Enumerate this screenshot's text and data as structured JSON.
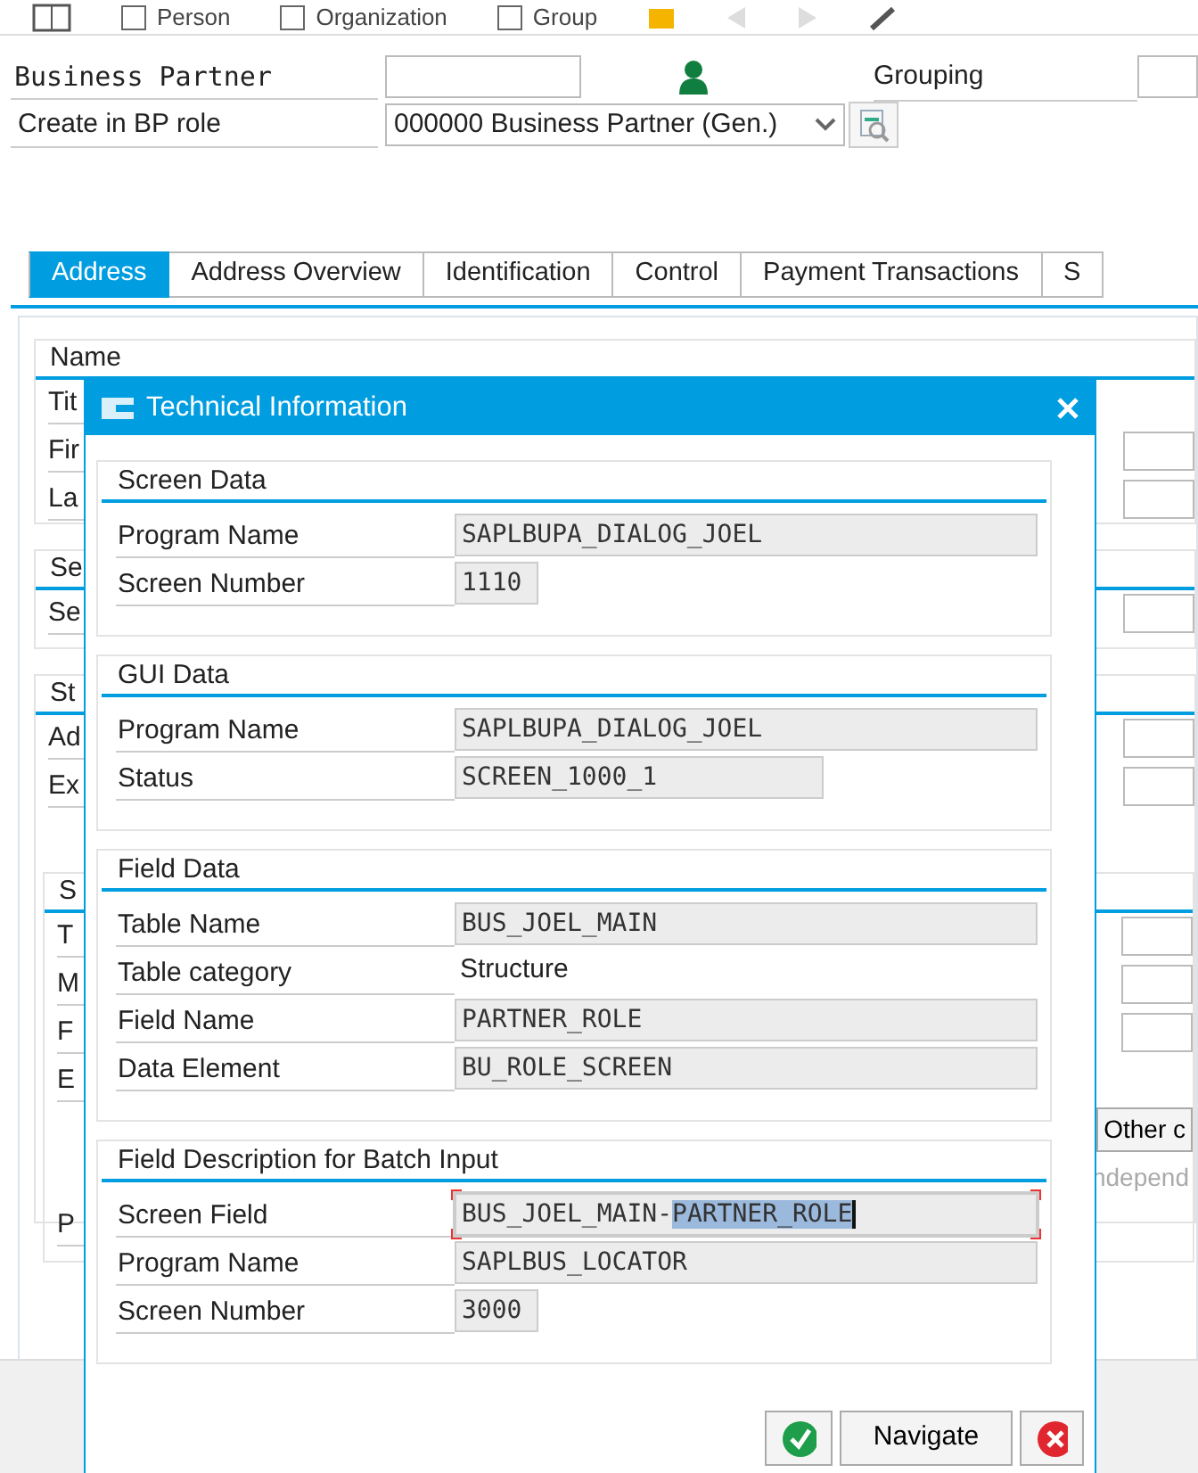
{
  "toolbar": {
    "buttons": [
      {
        "label": "Person",
        "checked": false
      },
      {
        "label": "Organization",
        "checked": false
      },
      {
        "label": "Group",
        "checked": false
      }
    ]
  },
  "header": {
    "business_partner": {
      "label": "Business Partner"
    },
    "grouping": {
      "label": "Grouping"
    },
    "role": {
      "label": "Create in BP role",
      "value": "000000 Business Partner (Gen.)"
    }
  },
  "tabs": [
    {
      "label": "Address",
      "selected": true
    },
    {
      "label": "Address Overview",
      "selected": false
    },
    {
      "label": "Identification",
      "selected": false
    },
    {
      "label": "Control",
      "selected": false
    },
    {
      "label": "Payment Transactions",
      "selected": false
    },
    {
      "label": "S",
      "selected": false
    }
  ],
  "background_groups": [
    {
      "title": "Name",
      "rows": [
        {
          "kind": "row",
          "label": "Tit",
          "field": false
        },
        {
          "kind": "row",
          "label": "Fir",
          "field": true
        },
        {
          "kind": "row",
          "label": "La",
          "field": true
        }
      ]
    },
    {
      "title": "Se",
      "rows": [
        {
          "kind": "row",
          "label": "Se",
          "field": true
        }
      ]
    },
    {
      "title": "St",
      "rows": [
        {
          "kind": "row",
          "label": "Ad",
          "field": true
        },
        {
          "kind": "row",
          "label": "Ex",
          "field": true
        }
      ],
      "subgroup": {
        "title": "S",
        "rows": [
          {
            "kind": "row",
            "label": "T",
            "field": true
          },
          {
            "kind": "row",
            "label": "M",
            "field": true
          },
          {
            "kind": "row",
            "label": "F",
            "field": true
          },
          {
            "kind": "row",
            "label": "E",
            "field": false
          },
          {
            "kind": "button",
            "text": "Other c"
          },
          {
            "kind": "disabled",
            "text": "ndepend"
          },
          {
            "kind": "row",
            "label": "P",
            "field": false
          }
        ]
      }
    }
  ],
  "dialog": {
    "title": "Technical Information",
    "groups": [
      {
        "title": "Screen Data",
        "rows": [
          {
            "label": "Program Name",
            "kind": "wide",
            "value": "SAPLBUPA_DIALOG_JOEL"
          },
          {
            "label": "Screen Number",
            "kind": "narrow",
            "value": "1110"
          }
        ]
      },
      {
        "title": "GUI Data",
        "rows": [
          {
            "label": "Program Name",
            "kind": "wide",
            "value": "SAPLBUPA_DIALOG_JOEL"
          },
          {
            "label": "Status",
            "kind": "medium",
            "value": "SCREEN_1000_1"
          }
        ]
      },
      {
        "title": "Field Data",
        "rows": [
          {
            "label": "Table Name",
            "kind": "wide",
            "value": "BUS_JOEL_MAIN"
          },
          {
            "label": "Table category",
            "kind": "plain",
            "value": "Structure"
          },
          {
            "label": "Field Name",
            "kind": "wide",
            "value": "PARTNER_ROLE"
          },
          {
            "label": "Data Element",
            "kind": "wide",
            "value": "BU_ROLE_SCREEN"
          }
        ]
      },
      {
        "title": "Field Description for Batch Input",
        "rows": [
          {
            "label": "Screen Field",
            "kind": "wide",
            "focused": true,
            "value_parts": [
              {
                "text": "BUS_JOEL_MAIN-",
                "selected": false
              },
              {
                "text": "PARTNER_ROLE",
                "selected": true
              }
            ]
          },
          {
            "label": "Program Name",
            "kind": "wide",
            "value": "SAPLBUS_LOCATOR"
          },
          {
            "label": "Screen Number",
            "kind": "narrow",
            "value": "3000"
          }
        ]
      }
    ],
    "buttons": [
      {
        "kind": "confirm"
      },
      {
        "kind": "text",
        "label": "Navigate"
      },
      {
        "kind": "cancel"
      }
    ]
  }
}
